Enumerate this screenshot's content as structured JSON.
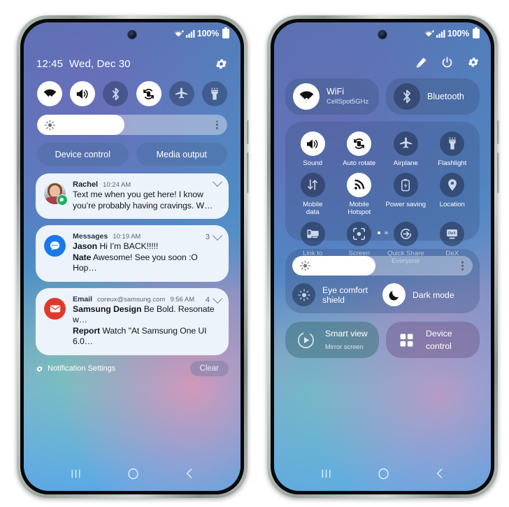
{
  "left_phone": {
    "status_bar": {
      "wifi": "wifi-icon",
      "signal": "signal-icon",
      "battery_percent": "100%"
    },
    "header": {
      "time": "12:45",
      "date": "Wed, Dec 30",
      "settings_icon": "gear-icon"
    },
    "toggles": [
      {
        "name": "wifi",
        "icon": "wifi-icon",
        "state": "on"
      },
      {
        "name": "sound",
        "icon": "volume-icon",
        "state": "on"
      },
      {
        "name": "bluetooth",
        "icon": "bluetooth-icon",
        "state": "off"
      },
      {
        "name": "auto-rotate",
        "icon": "auto-rotate-icon",
        "state": "on"
      },
      {
        "name": "airplane",
        "icon": "airplane-icon",
        "state": "off"
      },
      {
        "name": "flashlight",
        "icon": "flashlight-icon",
        "state": "off"
      }
    ],
    "brightness": {
      "icon": "brightness-icon",
      "value_percent": 46,
      "more_icon": "more-vertical-icon"
    },
    "pills": [
      {
        "label": "Device control"
      },
      {
        "label": "Media output"
      }
    ],
    "notifications": [
      {
        "app": "Rachel",
        "time": "10:24 AM",
        "count": "",
        "avatar": "contact-photo",
        "lines": [
          {
            "sender": "",
            "text": "Text me when you get here! I know"
          },
          {
            "sender": "",
            "text": "you’re probably having cravings. W…"
          }
        ]
      },
      {
        "app": "Messages",
        "time": "10:19 AM",
        "count": "3",
        "avatar": "messages-icon",
        "lines": [
          {
            "sender": "Jason",
            "text": "Hi I’m BACK!!!!!"
          },
          {
            "sender": "Nate",
            "text": "Awesome! See you soon :O Hop…"
          }
        ]
      },
      {
        "app": "Email",
        "address": "coreux@samsung.com",
        "time": "9:56 AM",
        "count": "4",
        "avatar": "email-icon",
        "lines": [
          {
            "sender": "Samsung Design",
            "text": "Be Bold. Resonate w…"
          },
          {
            "sender": "Report",
            "text": "Watch \"At Samsung One UI 6.0…"
          }
        ]
      }
    ],
    "footer": {
      "settings_icon": "gear-icon",
      "settings_label": "Notification Settings",
      "clear_label": "Clear"
    },
    "nav_bar": {
      "recents_label": "recents-icon",
      "home_label": "home-icon",
      "back_label": "back-icon"
    }
  },
  "right_phone": {
    "status_bar": {
      "wifi": "wifi-icon",
      "signal": "signal-icon",
      "battery_percent": "100%"
    },
    "header_icons": [
      {
        "name": "edit-icon"
      },
      {
        "name": "power-icon"
      },
      {
        "name": "gear-icon"
      }
    ],
    "big_tiles": [
      {
        "icon": "wifi-icon",
        "title": "WiFi",
        "subtitle": "CellSpot5GHz",
        "state": "on"
      },
      {
        "icon": "bluetooth-icon",
        "title": "Bluetooth",
        "subtitle": "",
        "state": "off"
      }
    ],
    "grid": {
      "rows": [
        [
          {
            "icon": "volume-icon",
            "label": "Sound",
            "state": "on"
          },
          {
            "icon": "auto-rotate-icon",
            "label": "Auto rotate",
            "state": "on"
          },
          {
            "icon": "airplane-icon",
            "label": "Airplane",
            "state": "off"
          },
          {
            "icon": "flashlight-icon",
            "label": "Flashlight",
            "state": "off"
          }
        ],
        [
          {
            "icon": "mobile-data-icon",
            "label": "Mobile\ndata",
            "state": "off"
          },
          {
            "icon": "hotspot-icon",
            "label": "Mobile\nHotspot",
            "state": "on"
          },
          {
            "icon": "power-saving-icon",
            "label": "Power saving",
            "state": "off"
          },
          {
            "icon": "location-icon",
            "label": "Location",
            "state": "off"
          }
        ],
        [
          {
            "icon": "link-to-windows-icon",
            "label": "Link to\nWindows",
            "state": "off"
          },
          {
            "icon": "screen-recorder-icon",
            "label": "Screen\nrecorder",
            "state": "off"
          },
          {
            "icon": "quick-share-icon",
            "label": "Quick Share\nEveryone",
            "state": "off"
          },
          {
            "icon": "dex-icon",
            "label": "DeX",
            "state": "off"
          }
        ]
      ],
      "page_dots": {
        "total": 2,
        "active_index": 0
      }
    },
    "brightness": {
      "icon": "brightness-icon",
      "value_percent": 46,
      "more_icon": "more-vertical-icon"
    },
    "modes": [
      {
        "icon": "eye-comfort-icon",
        "label": "Eye comfort shield",
        "state": "off"
      },
      {
        "icon": "moon-icon",
        "label": "Dark mode",
        "state": "on"
      }
    ],
    "bottom_tiles": [
      {
        "icon": "smart-view-icon",
        "title": "Smart view",
        "subtitle": "Mirror screen"
      },
      {
        "icon": "device-control-icon",
        "title": "Device control",
        "subtitle": ""
      }
    ],
    "nav_bar": {
      "recents_label": "recents-icon",
      "home_label": "home-icon",
      "back_label": "back-icon"
    }
  },
  "colors": {
    "accent_white": "#ffffff",
    "tile_inactive": "rgba(30,44,72,.52)",
    "notification_card": "#edf3fb",
    "messages_blue": "#1a79ea",
    "email_red": "#e0392b",
    "badge_green": "#18b45a"
  }
}
